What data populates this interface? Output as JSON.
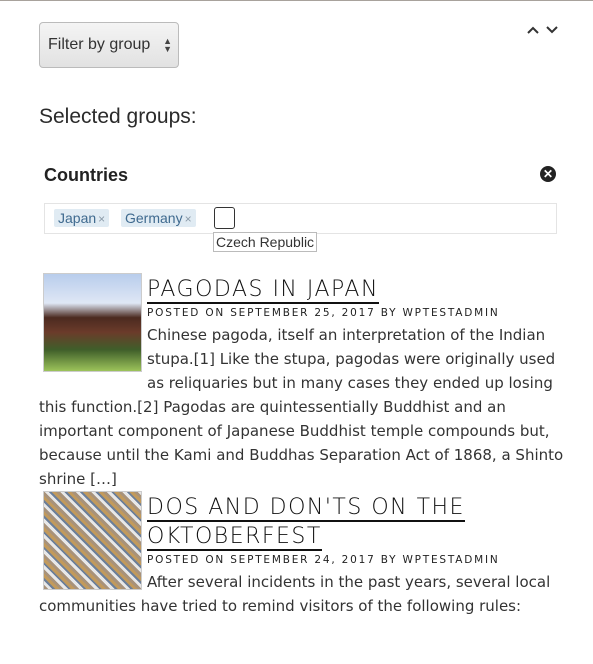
{
  "filter": {
    "label": "Filter by group"
  },
  "nav": {
    "up": "⌃",
    "down": "⌄"
  },
  "selected_title": "Selected groups:",
  "group": {
    "name": "Countries",
    "tags": [
      "Japan",
      "Germany"
    ],
    "tag_remove": "×",
    "suggestion": "Czech Republic"
  },
  "posts": [
    {
      "title": "PAGODAS IN JAPAN",
      "meta": "POSTED ON SEPTEMBER 25, 2017 BY WPTESTADMIN",
      "excerpt": "Chinese pagoda, itself an interpretation of the Indian stupa.[1] Like the stupa, pagodas were originally used as reliquaries but in many cases they ended up losing this function.[2] Pagodas are quintessentially Buddhist and an important component of Japanese Buddhist temple compounds but, because until the Kami and Buddhas Separation Act of 1868, a Shinto shrine […]"
    },
    {
      "title": "DOS AND DON'TS ON THE OKTOBERFEST",
      "meta": "POSTED ON SEPTEMBER 24, 2017 BY WPTESTADMIN",
      "excerpt": "After several incidents in the past years, several local communities have tried to remind visitors of the following rules:"
    }
  ]
}
